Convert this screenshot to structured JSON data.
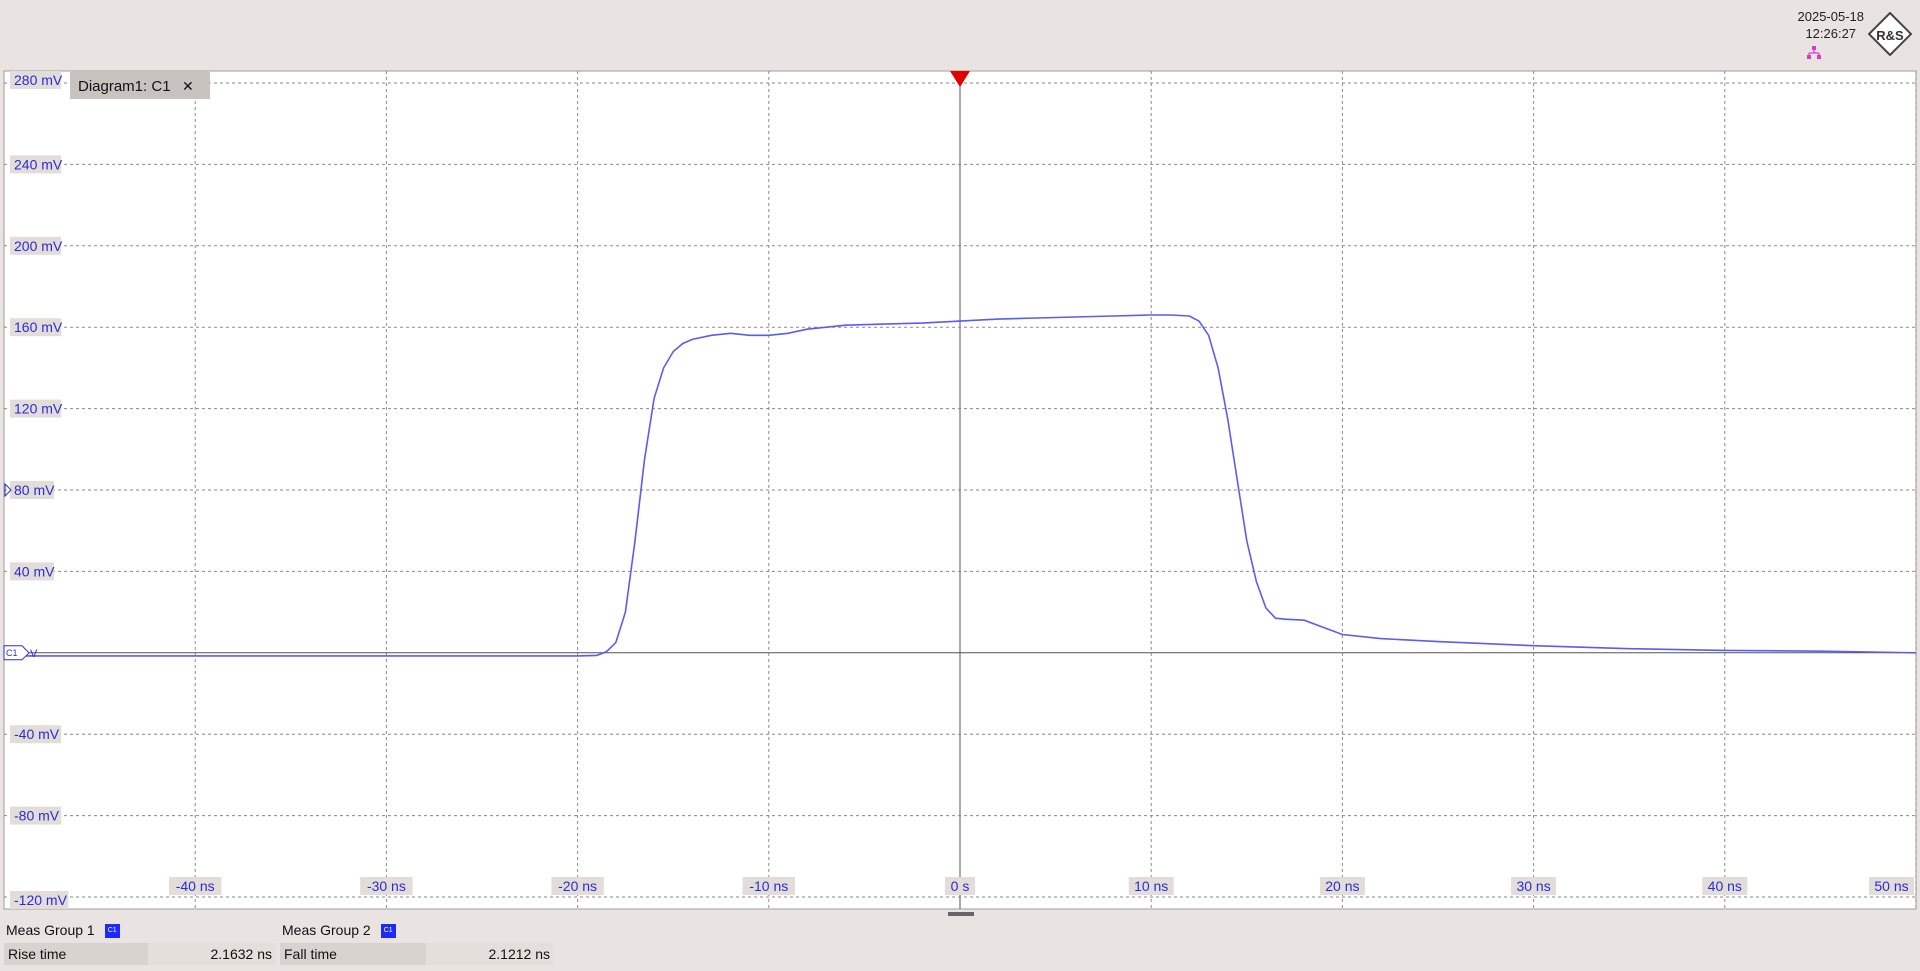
{
  "header": {
    "date": "2025-05-18",
    "time": "12:26:27",
    "logo_text": "R&S"
  },
  "diagram": {
    "tab_label": "Diagram1: C1",
    "close_glyph": "✕",
    "channel_marker": "C1",
    "channel_marker_unit": "V",
    "colors": {
      "trace": "#5b5cf0",
      "grid": "#8a8a8a",
      "trigger": "#e00000",
      "label_bg": "#e3ddd9",
      "label_text": "#2b2bd6",
      "background": "#ffffff"
    }
  },
  "chart_data": {
    "type": "line",
    "title": "",
    "xlabel": "",
    "ylabel": "",
    "x_unit": "ns",
    "y_unit": "mV",
    "xlim": [
      -50,
      50
    ],
    "ylim": [
      -120,
      280
    ],
    "grid": true,
    "y_tick_labels": [
      "280 mV",
      "240 mV",
      "200 mV",
      "160 mV",
      "120 mV",
      "80 mV",
      "40 mV",
      "",
      "-40 mV",
      "-80 mV",
      "-120 mV"
    ],
    "y_ticks": [
      280,
      240,
      200,
      160,
      120,
      80,
      40,
      0,
      -40,
      -80,
      -120
    ],
    "x_tick_labels": [
      "-40 ns",
      "-30 ns",
      "-20 ns",
      "-10 ns",
      "0 s",
      "10 ns",
      "20 ns",
      "30 ns",
      "40 ns",
      "50 ns"
    ],
    "x_ticks": [
      -40,
      -30,
      -20,
      -10,
      0,
      10,
      20,
      30,
      40,
      50
    ],
    "trigger_x": 0,
    "offset_marker_y": 80,
    "series": [
      {
        "x": [
          -50,
          -40,
          -30,
          -20,
          -19,
          -18.5,
          -18,
          -17.5,
          -17,
          -16.5,
          -16,
          -15.5,
          -15,
          -14.5,
          -14,
          -13,
          -12,
          -11,
          -10,
          -9,
          -8,
          -7,
          -6,
          -4,
          -2,
          0,
          2,
          4,
          6,
          8,
          10,
          11,
          12,
          12.5,
          13,
          13.5,
          14,
          14.5,
          15,
          15.5,
          16,
          16.5,
          17,
          18,
          19,
          20,
          22,
          25,
          30,
          35,
          40,
          45,
          50
        ],
        "y": [
          -1.5,
          -1.5,
          -1.5,
          -1.5,
          -1.3,
          0.5,
          5,
          20,
          55,
          95,
          125,
          140,
          148,
          152,
          154,
          156,
          157,
          156,
          156,
          157,
          159,
          160,
          161,
          161.5,
          162,
          163,
          164,
          164.5,
          165,
          165.5,
          166,
          166,
          165.5,
          163,
          156,
          140,
          115,
          85,
          55,
          35,
          22,
          17,
          16.5,
          16,
          12.5,
          9,
          7,
          5.5,
          3.5,
          2,
          1.2,
          0.8,
          0
        ]
      }
    ]
  },
  "measurements": {
    "groups": [
      {
        "title": "Meas Group 1",
        "badge": "C1",
        "label": "Rise time",
        "value": "2.1632 ns"
      },
      {
        "title": "Meas Group 2",
        "badge": "C1",
        "label": "Fall time",
        "value": "2.1212 ns"
      }
    ]
  }
}
